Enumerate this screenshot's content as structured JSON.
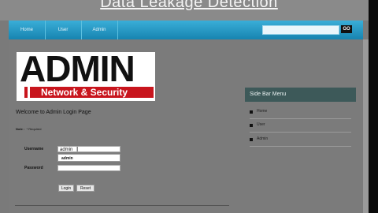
{
  "video_title": "Data Leakage Detection",
  "nav": {
    "items": [
      "Home",
      "User",
      "Admin"
    ],
    "search_placeholder": "",
    "go_label": "GO"
  },
  "logo": {
    "word": "ADMIN",
    "tagline": "Network & Security"
  },
  "login": {
    "heading": "Welcome to Admin Login Page",
    "note_label": "Note :",
    "note_text": "* Required",
    "username_label": "Username",
    "username_value": "admin",
    "password_label": "Password",
    "password_value": "",
    "autocomplete_suggestion": "admin",
    "login_button": "Login",
    "reset_button": "Reset"
  },
  "sidebar": {
    "title": "Side Bar Menu",
    "items": [
      "Home",
      "User",
      "Admin"
    ]
  },
  "colors": {
    "nav": "#1f97c5",
    "sidebar_header": "#3d5959",
    "logo_red": "#c8151d"
  }
}
